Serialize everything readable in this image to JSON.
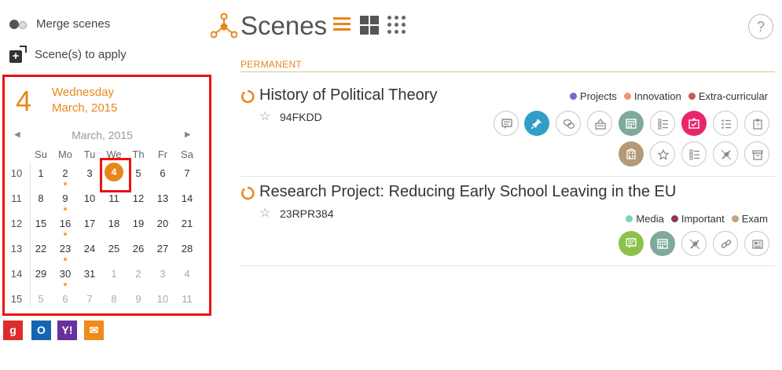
{
  "sidebar": {
    "merge_label": "Merge scenes",
    "apply_label": "Scene(s) to apply"
  },
  "calendar": {
    "day_number": "4",
    "weekday": "Wednesday",
    "month_year": "March, 2015",
    "nav_month": "March, 2015",
    "prev": "◀",
    "next": "▶",
    "headers": [
      "Su",
      "Mo",
      "Tu",
      "We",
      "Th",
      "Fr",
      "Sa"
    ],
    "weeks": [
      {
        "wk": "10",
        "days": [
          "1",
          "2",
          "3",
          "4",
          "5",
          "6",
          "7"
        ]
      },
      {
        "wk": "11",
        "days": [
          "8",
          "9",
          "10",
          "11",
          "12",
          "13",
          "14"
        ]
      },
      {
        "wk": "12",
        "days": [
          "15",
          "16",
          "17",
          "18",
          "19",
          "20",
          "21"
        ]
      },
      {
        "wk": "13",
        "days": [
          "22",
          "23",
          "24",
          "25",
          "26",
          "27",
          "28"
        ]
      },
      {
        "wk": "14",
        "days": [
          "29",
          "30",
          "31",
          "1",
          "2",
          "3",
          "4"
        ]
      },
      {
        "wk": "15",
        "days": [
          "5",
          "6",
          "7",
          "8",
          "9",
          "10",
          "11"
        ]
      }
    ]
  },
  "providers": [
    {
      "name": "google",
      "label": "g",
      "color": "#dd2c2c"
    },
    {
      "name": "outlook",
      "label": "O",
      "color": "#1565b0"
    },
    {
      "name": "yahoo",
      "label": "Y!",
      "color": "#6b2fa0"
    },
    {
      "name": "mail",
      "label": "✉",
      "color": "#f08a1c"
    }
  ],
  "header": {
    "title": "Scenes",
    "help": "?"
  },
  "section_label": "PERMANENT",
  "scenes": [
    {
      "title": "History of Political Theory",
      "star": "☆",
      "code": "94FKDD",
      "tags": [
        {
          "label": "Projects",
          "color": "#6a6ec8"
        },
        {
          "label": "Innovation",
          "color": "#f0956a"
        },
        {
          "label": "Extra-curricular",
          "color": "#c75a5a"
        }
      ],
      "tools": [
        {
          "icon": "comment-icon",
          "color": "#fff"
        },
        {
          "icon": "pin-icon",
          "color": "#2f9fc7"
        },
        {
          "icon": "chat-icon",
          "color": "#fff"
        },
        {
          "icon": "inbox-icon",
          "color": "#fff"
        },
        {
          "icon": "calendar-icon",
          "color": "#7faa9a"
        },
        {
          "icon": "list-icon",
          "color": "#fff"
        },
        {
          "icon": "task-icon",
          "color": "#e8266b"
        },
        {
          "icon": "checklist-icon",
          "color": "#fff"
        },
        {
          "icon": "clipboard-icon",
          "color": "#fff"
        },
        {
          "icon": "building-icon",
          "color": "#b49a78"
        },
        {
          "icon": "star-icon",
          "color": "#fff"
        },
        {
          "icon": "list-icon",
          "color": "#fff"
        },
        {
          "icon": "link-off-icon",
          "color": "#fff"
        },
        {
          "icon": "archive-icon",
          "color": "#fff"
        }
      ]
    },
    {
      "title": "Research Project: Reducing Early School Leaving in the EU",
      "star": "☆",
      "code": "23RPR384",
      "tags": [
        {
          "label": "Media",
          "color": "#7fd4b8"
        },
        {
          "label": "Important",
          "color": "#8a3a4a"
        },
        {
          "label": "Exam",
          "color": "#c2a57a"
        }
      ],
      "tools": [
        {
          "icon": "comment-icon",
          "color": "#8cc24a"
        },
        {
          "icon": "calendar-icon",
          "color": "#7faa9a"
        },
        {
          "icon": "link-off-icon",
          "color": "#fff"
        },
        {
          "icon": "link-icon",
          "color": "#fff"
        },
        {
          "icon": "newspaper-icon",
          "color": "#fff"
        }
      ]
    }
  ],
  "colors": {
    "accent": "#e8861a",
    "highlight": "#e11111"
  }
}
